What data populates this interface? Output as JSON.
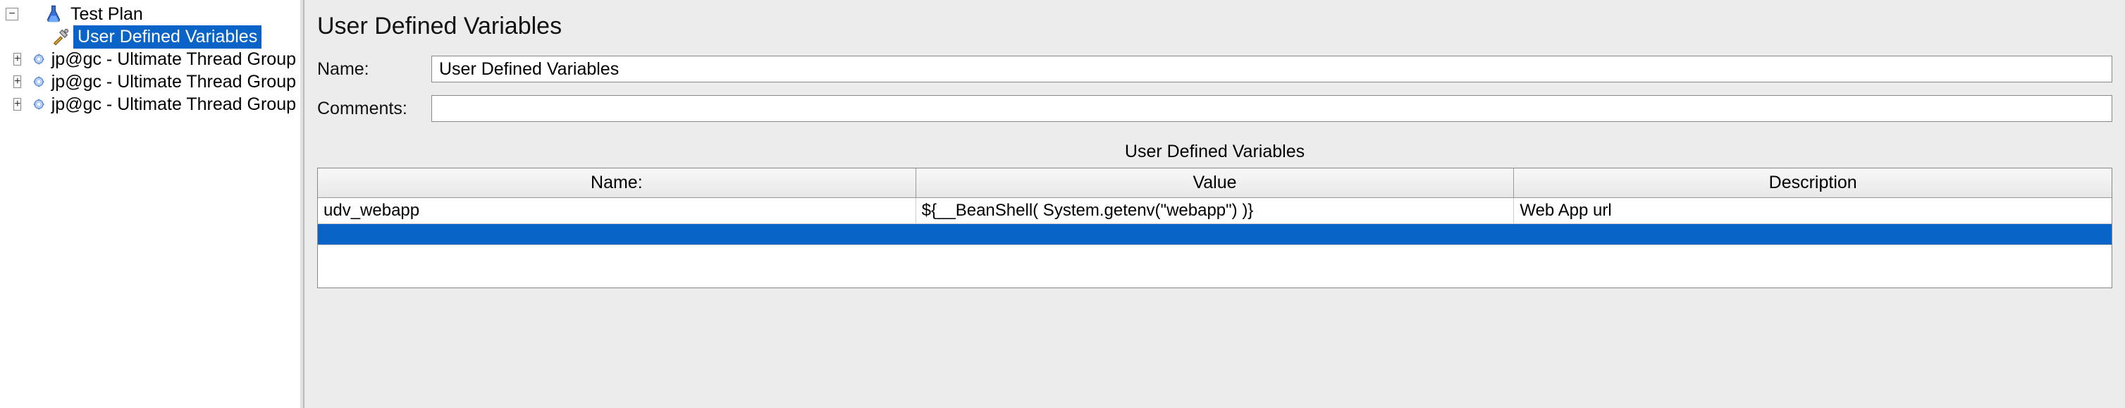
{
  "tree": {
    "root": {
      "label": "Test Plan"
    },
    "children": [
      {
        "label": "User Defined Variables",
        "icon": "tools",
        "selected": true
      },
      {
        "label": "jp@gc - Ultimate Thread Group",
        "icon": "gear",
        "expandable": true
      },
      {
        "label": "jp@gc - Ultimate Thread Group",
        "icon": "gear",
        "expandable": true
      },
      {
        "label": "jp@gc - Ultimate Thread Group",
        "icon": "gear",
        "expandable": true
      }
    ]
  },
  "main": {
    "title": "User Defined Variables",
    "name_label": "Name:",
    "name_value": "User Defined Variables",
    "comments_label": "Comments:",
    "comments_value": "",
    "section_title": "User Defined Variables",
    "columns": {
      "name": "Name:",
      "value": "Value",
      "description": "Description"
    },
    "rows": [
      {
        "name": "udv_webapp",
        "value": "${__BeanShell( System.getenv(\"webapp\") )}",
        "description": "Web App url"
      }
    ]
  }
}
